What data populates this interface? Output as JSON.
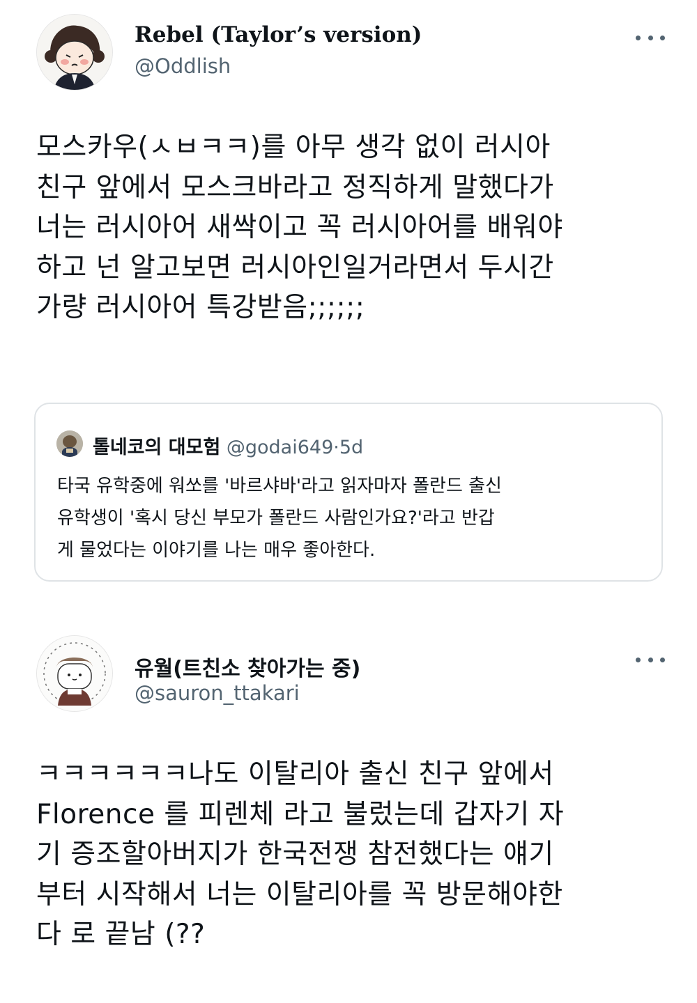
{
  "tweets": [
    {
      "display_name": "Rebel (Taylor’s version)",
      "handle": "@Oddlish",
      "text": "모스카우(ㅅㅂㅋㅋ)를 아무 생각 없이 러시아\n친구 앞에서 모스크바라고 정직하게 말했다가\n너는 러시아어 새싹이고 꼭 러시아어를 배워야\n하고 넌 알고보면 러시아인일거라면서 두시간\n가량 러시아어 특강받음;;;;;;",
      "quote": {
        "display_name": "톨네코의 대모험",
        "handle": "@godai649",
        "separator": "·",
        "time": "5d",
        "text": "타국 유학중에 워쏘를 '바르샤바'라고 읽자마자 폴란드 출신\n유학생이 '혹시 당신 부모가 폴란드 사람인가요?'라고 반갑\n게 물었다는 이야기를 나는 매우 좋아한다."
      }
    },
    {
      "display_name": "유월(트친소 찾아가는 중)",
      "handle": "@sauron_ttakari",
      "text": "ㅋㅋㅋㅋㅋㅋ나도 이탈리아 출신 친구 앞에서\nFlorence 를 피렌체 라고 불렀는데 갑자기 자\n기 증조할아버지가 한국전쟁 참전했다는 얘기\n부터 시작해서 너는 이탈리아를 꼭 방문해야한\n다 로 끝남 (??"
    }
  ],
  "icons": {
    "more": "more-horizontal-icon"
  },
  "colors": {
    "text": "#0f1419",
    "secondary": "#536471",
    "border": "#dfe3e6"
  }
}
